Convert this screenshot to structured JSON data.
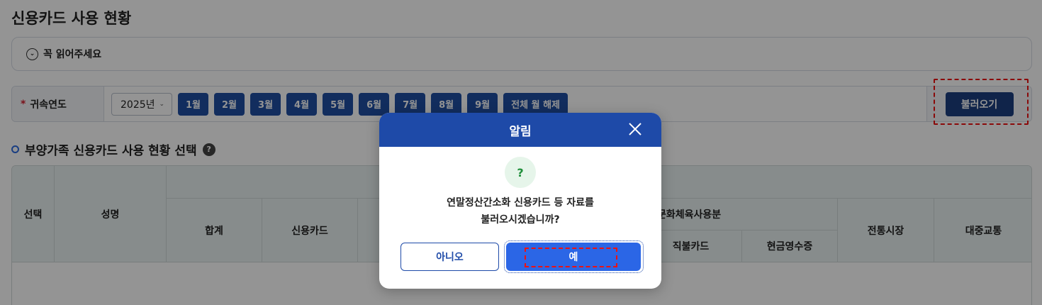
{
  "page": {
    "title": "신용카드 사용 현황"
  },
  "notice": {
    "label": "꼭 읽어주세요"
  },
  "filter": {
    "label": "귀속연도",
    "required_mark": "*",
    "year": "2025년",
    "months": [
      "1월",
      "2월",
      "3월",
      "4월",
      "5월",
      "6월",
      "7월",
      "8월",
      "9월"
    ],
    "clear_all": "전체 월 해제",
    "load": "불러오기"
  },
  "section": {
    "title": "부양가족 신용카드 사용 현황 선택",
    "help": "?"
  },
  "table": {
    "headers": {
      "select": "선택",
      "name": "성명",
      "total": "합계",
      "credit_card": "신용카드",
      "culture": "문화체육사용분",
      "debit_card": "직불카드",
      "cash_receipt": "현금영수증",
      "market": "전통시장",
      "transit": "대중교통"
    }
  },
  "dialog": {
    "title": "알림",
    "icon": "?",
    "message_line1": "연말정산간소화 신용카드 등 자료를",
    "message_line2": "불러오시겠습니까?",
    "no": "아니오",
    "yes": "예"
  }
}
